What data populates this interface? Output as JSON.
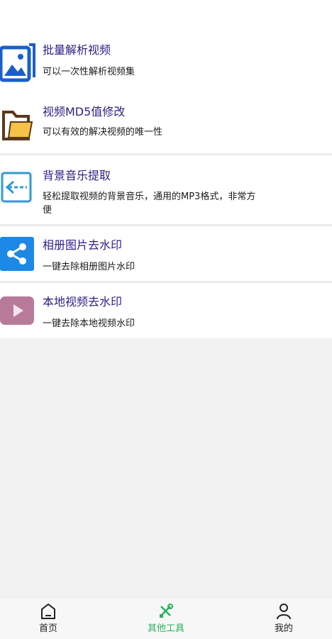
{
  "colors": {
    "accent": "#2ab05a",
    "title_text": "#2b1f86",
    "tab_text": "#222222"
  },
  "tools": [
    {
      "title": "批量解析视频",
      "desc": "可以一次性解析视频集",
      "icon": "image-gallery-icon",
      "icon_color": "#1a5fc8"
    },
    {
      "title": "视频MD5值修改",
      "desc": "可以有效的解决视频的唯一性",
      "icon": "folder-icon",
      "icon_color": "#f6c247"
    },
    {
      "title": "背景音乐提取",
      "desc": "轻松提取视频的背景音乐，通用的MP3格式，非常方便",
      "icon": "import-arrow-icon",
      "icon_color": "#2f9bd3"
    },
    {
      "title": "相册图片去水印",
      "desc": "一键去除相册图片水印",
      "icon": "share-icon",
      "icon_color": "#1e88e5"
    },
    {
      "title": "本地视频去水印",
      "desc": "一键去除本地视频水印",
      "icon": "play-icon",
      "icon_color": "#b77a99"
    }
  ],
  "tabbar": {
    "items": [
      {
        "label": "首页",
        "icon": "home-icon"
      },
      {
        "label": "其他工具",
        "icon": "tools-icon",
        "active": true
      },
      {
        "label": "我的",
        "icon": "user-icon"
      }
    ]
  }
}
